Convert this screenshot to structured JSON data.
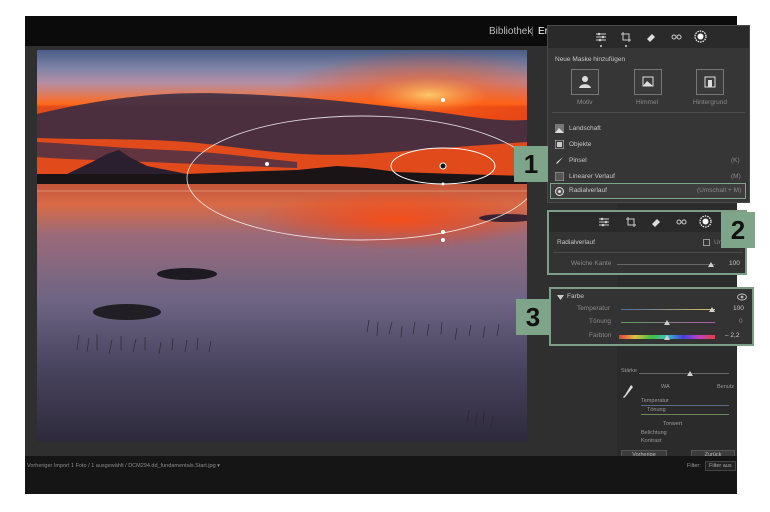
{
  "topbar": {
    "module_library": "Bibliothek",
    "module_separator": "|",
    "module_develop": "Ent"
  },
  "masks": {
    "title": "Neue Maske hinzufügen",
    "types": [
      {
        "label": "Motiv"
      },
      {
        "label": "Himmel"
      },
      {
        "label": "Hintergrund"
      }
    ],
    "tools": [
      {
        "label": "Landschaft",
        "shortcut": ""
      },
      {
        "label": "Objekte",
        "shortcut": ""
      },
      {
        "label": "Pinsel",
        "shortcut": "(K)"
      },
      {
        "label": "Linearer Verlauf",
        "shortcut": "(M)"
      },
      {
        "label": "Radialverlauf",
        "shortcut": "(Umschalt + M)"
      }
    ]
  },
  "callouts": {
    "one": "1",
    "two": "2",
    "three": "3"
  },
  "radial_panel": {
    "title": "Radialverlauf",
    "invert_label": "Um",
    "feather_label": "Weiche Kante",
    "feather_value": "100",
    "feather_fraction": 1.0
  },
  "color_panel": {
    "title": "Farbe",
    "temp_label": "Temperatur",
    "temp_value": "100",
    "tint_label": "Tönung",
    "tint_value": "0",
    "hue_label": "Farbton",
    "hue_value": "– 2,2"
  },
  "panel_misc": {
    "staerke": "Stärke",
    "wb": "WA",
    "wb_user": "Benutz",
    "temperatur": "Temperatur",
    "toenung": "Tönung",
    "toenung_header": "Tonwert",
    "belichtung": "Belichtung",
    "kontrast": "Kontrast",
    "btn_prev": "Vorherige",
    "btn_reset": "Zurück"
  },
  "filmstrip": {
    "breadcrumb": "Vorheriger Import  1 Foto / 1 ausgewählt / DCM294.dd_fundamentals.Start.jpg ▾",
    "filter_label": "Filter:",
    "filter_value": "Filter aus"
  },
  "colors": {
    "accent": "#7ea489",
    "app_bg": "#121212",
    "panel_bg": "#2b2b2b"
  }
}
